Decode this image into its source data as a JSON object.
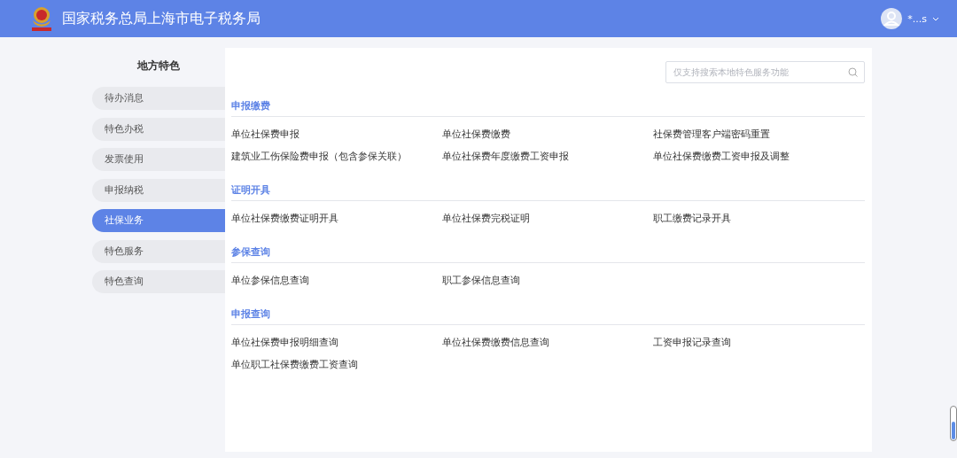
{
  "header": {
    "title": "国家税务总局上海市电子税务局",
    "user": "*...s"
  },
  "sidebar": {
    "title": "地方特色",
    "items": [
      {
        "label": "待办消息",
        "selected": false
      },
      {
        "label": "特色办税",
        "selected": false
      },
      {
        "label": "发票使用",
        "selected": false
      },
      {
        "label": "申报纳税",
        "selected": false
      },
      {
        "label": "社保业务",
        "selected": true
      },
      {
        "label": "特色服务",
        "selected": false
      },
      {
        "label": "特色查询",
        "selected": false
      }
    ]
  },
  "search": {
    "placeholder": "仅支持搜索本地特色服务功能"
  },
  "sections": [
    {
      "title": "申报缴费",
      "items": [
        "单位社保费申报",
        "单位社保费缴费",
        "社保费管理客户端密码重置",
        "建筑业工伤保险费申报（包含参保关联）",
        "单位社保费年度缴费工资申报",
        "单位社保费缴费工资申报及调整"
      ]
    },
    {
      "title": "证明开具",
      "items": [
        "单位社保费缴费证明开具",
        "单位社保费完税证明",
        "职工缴费记录开具"
      ]
    },
    {
      "title": "参保查询",
      "items": [
        "单位参保信息查询",
        "职工参保信息查询"
      ]
    },
    {
      "title": "申报查询",
      "items": [
        "单位社保费申报明细查询",
        "单位社保费缴费信息查询",
        "工资申报记录查询",
        "单位职工社保费缴费工资查询"
      ]
    }
  ]
}
